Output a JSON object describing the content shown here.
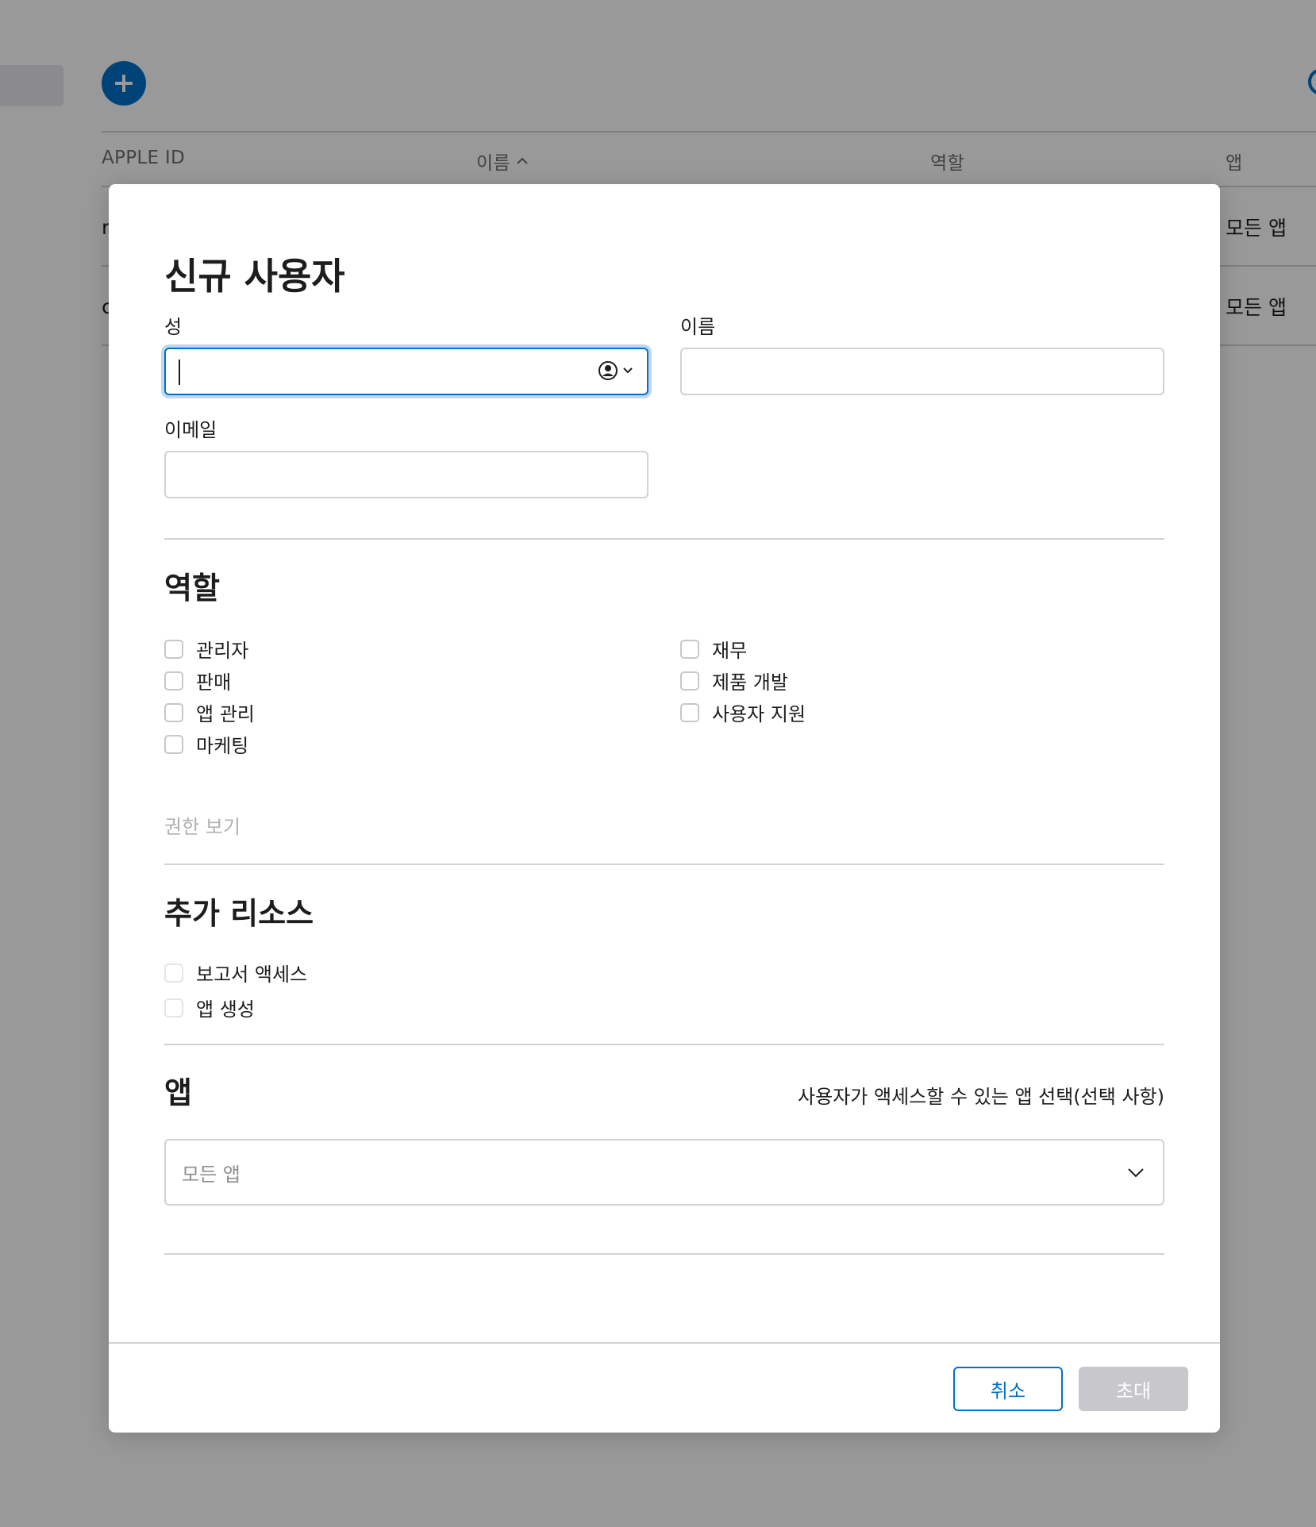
{
  "background": {
    "table": {
      "columns": [
        "APPLE ID",
        "이름",
        "역할",
        "앱"
      ],
      "rows": [
        {
          "apple_id": "r",
          "apps": "모든 앱"
        },
        {
          "apple_id": "c",
          "apps": "모든 앱"
        }
      ]
    },
    "add_icon": "plus-icon",
    "search_icon": "search-icon",
    "sort_icon": "chevron-up-icon"
  },
  "modal": {
    "title": "신규 사용자",
    "fields": {
      "last_name": {
        "label": "성",
        "value": ""
      },
      "first_name": {
        "label": "이름",
        "value": ""
      },
      "email": {
        "label": "이메일",
        "value": ""
      }
    },
    "roles": {
      "title": "역할",
      "left": [
        "관리자",
        "판매",
        "앱 관리",
        "마케팅"
      ],
      "right": [
        "재무",
        "제품 개발",
        "사용자 지원"
      ],
      "view_permissions": "권한 보기"
    },
    "resources": {
      "title": "추가 리소스",
      "items": [
        "보고서 액세스",
        "앱 생성"
      ]
    },
    "apps": {
      "title": "앱",
      "hint": "사용자가 액세스할 수 있는 앱 선택(선택 사항)",
      "selected": "모든 앱"
    },
    "buttons": {
      "cancel": "취소",
      "invite": "초대"
    }
  },
  "colors": {
    "accent": "#0071c9",
    "disabled": "#c7c7cc"
  }
}
